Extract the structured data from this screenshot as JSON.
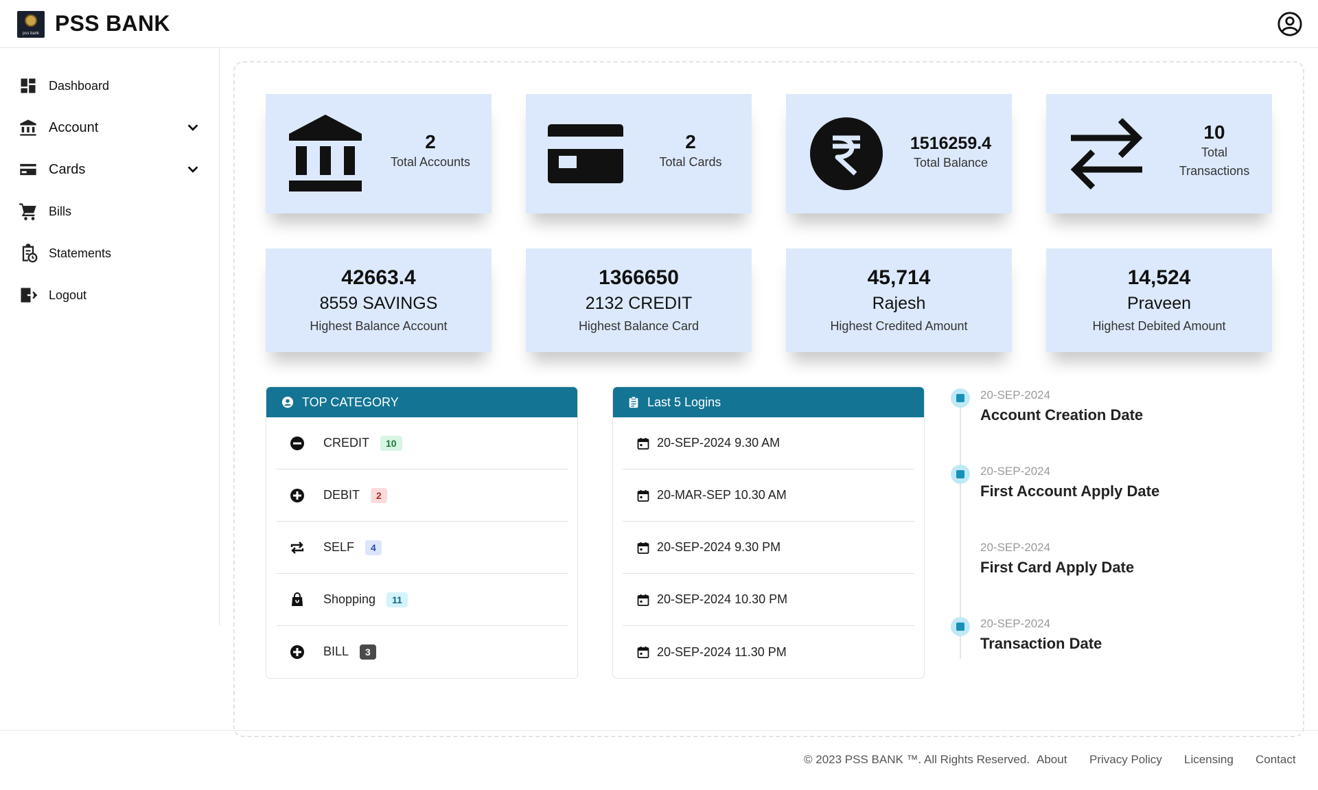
{
  "header": {
    "brand": "PSS BANK",
    "logo_text": "pss bank"
  },
  "sidebar": {
    "items": [
      {
        "label": "Dashboard",
        "icon": "dashboard-icon"
      },
      {
        "label": "Account",
        "icon": "bank-icon",
        "expandable": true
      },
      {
        "label": "Cards",
        "icon": "card-icon",
        "expandable": true
      },
      {
        "label": "Bills",
        "icon": "cart-icon"
      },
      {
        "label": "Statements",
        "icon": "clipboard-clock-icon"
      },
      {
        "label": "Logout",
        "icon": "logout-icon"
      }
    ]
  },
  "summary": [
    {
      "value": "2",
      "label": "Total Accounts",
      "icon": "bank-icon"
    },
    {
      "value": "2",
      "label": "Total Cards",
      "icon": "card-icon"
    },
    {
      "value": "1516259.4",
      "label": "Total Balance",
      "icon": "rupee-icon"
    },
    {
      "value": "10",
      "label_line1": "Total",
      "label_line2": "Transactions",
      "icon": "exchange-icon"
    }
  ],
  "highlights": [
    {
      "value": "42663.4",
      "name": "8559 SAVINGS",
      "label": "Highest Balance Account"
    },
    {
      "value": "1366650",
      "name": "2132 CREDIT",
      "label": "Highest Balance Card"
    },
    {
      "value": "45,714",
      "name": "Rajesh",
      "label": "Highest Credited Amount"
    },
    {
      "value": "14,524",
      "name": "Praveen",
      "label": "Highest Debited Amount"
    }
  ],
  "top_category": {
    "title": "TOP CATEGORY",
    "rows": [
      {
        "label": "CREDIT",
        "count": "10",
        "icon": "minus-circle-icon",
        "badge_bg": "#d9f5e3",
        "badge_fg": "#1a7a3e"
      },
      {
        "label": "DEBIT",
        "count": "2",
        "icon": "plus-circle-icon",
        "badge_bg": "#fbdada",
        "badge_fg": "#b02a2a"
      },
      {
        "label": "SELF",
        "count": "4",
        "icon": "repeat-icon",
        "badge_bg": "#dce6fb",
        "badge_fg": "#2a4fb0"
      },
      {
        "label": "Shopping",
        "count": "11",
        "icon": "shopping-bag-icon",
        "badge_bg": "#d4f3fb",
        "badge_fg": "#136a80"
      },
      {
        "label": "BILL",
        "count": "3",
        "icon": "plus-circle-icon",
        "badge_bg": "#4a4a4a",
        "badge_fg": "#ffffff"
      }
    ]
  },
  "logins": {
    "title": "Last 5 Logins",
    "rows": [
      "20-SEP-2024 9.30 AM",
      "20-MAR-SEP 10.30 AM",
      "20-SEP-2024 9.30 PM",
      "20-SEP-2024 10.30 PM",
      "20-SEP-2024 11.30 PM"
    ]
  },
  "timeline": [
    {
      "date": "20-SEP-2024",
      "title": "Account Creation Date",
      "dot": true
    },
    {
      "date": "20-SEP-2024",
      "title": "First Account Apply Date",
      "dot": true
    },
    {
      "date": "20-SEP-2024",
      "title": "First Card Apply Date",
      "dot": false
    },
    {
      "date": "20-SEP-2024",
      "title": "Transaction Date",
      "dot": true
    }
  ],
  "footer": {
    "copyright": "© 2023 PSS BANK ™. All Rights Reserved.",
    "links": [
      "About",
      "Privacy Policy",
      "Licensing",
      "Contact"
    ]
  },
  "colors": {
    "card_bg": "#dce9fc",
    "panel_header": "#137494",
    "timeline_dot": "#bfe9f6"
  }
}
